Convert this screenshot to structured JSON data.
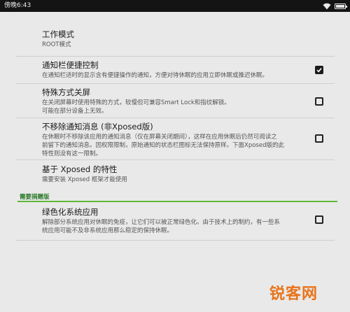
{
  "status_bar": {
    "time": "傍晚6:43"
  },
  "prefs": [
    {
      "title": "工作模式",
      "summary": "ROOT模式"
    },
    {
      "title": "通知栏便捷控制",
      "summary": "在通知栏适时的显示含有便捷操作的通知，方便对待休眠的应用立即休眠或推迟休眠。",
      "checked": true
    },
    {
      "title": "特殊方式关屏",
      "summary1": "在关闭屏幕时使用特殊的方式，较慢但可兼容Smart Lock和指纹解锁。",
      "summary2": "可能在部分设备上无效。",
      "checked": false
    },
    {
      "title": "不移除通知消息 (非Xposed版)",
      "summary1": "在休眠时不移除该应用的通知消息（仅在屏幕关闭期间），这样在应用休眠后仍然可阅读之",
      "summary2": "前留下的通知消息。因权限限制，原始通知的状态栏图标无法保持原样。下面Xposed版的此",
      "summary3": "特性则没有这一限制。",
      "checked": false
    },
    {
      "title": "基于 Xposed 的特性",
      "summary": "需要安装 Xposed 框架才能使用"
    },
    {
      "title": "绿色化系统应用",
      "summary1": "解除部分系统应用对休眠的免疫，让它们可以被正常绿色化。由于技术上的制约，有一些系",
      "summary2": "统应用可能不及非系统应用那么稳定的保持休眠。",
      "checked": false
    }
  ],
  "category": {
    "label": "需要捐赠版"
  },
  "watermark": {
    "text": "锐客网"
  }
}
